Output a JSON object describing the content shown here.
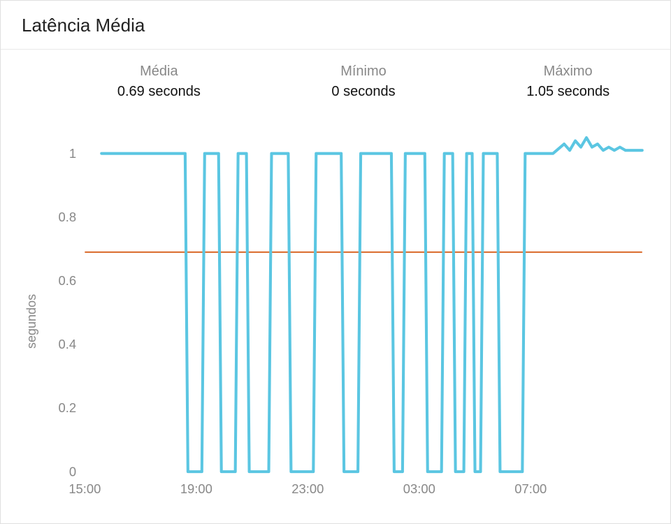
{
  "title": "Latência Média",
  "stats": {
    "mean_label": "Média",
    "mean_value": "0.69 seconds",
    "min_label": "Mínimo",
    "min_value": "0 seconds",
    "max_label": "Máximo",
    "max_value": "1.05 seconds"
  },
  "y_axis_title": "segundos",
  "chart_data": {
    "type": "line",
    "xlabel": "",
    "ylabel": "segundos",
    "ylim": [
      0,
      1.1
    ],
    "xlim": [
      15,
      35
    ],
    "x_tick_labels": [
      "15:00",
      "19:00",
      "23:00",
      "03:00",
      "07:00"
    ],
    "x_tick_positions": [
      15,
      19,
      23,
      27,
      31
    ],
    "y_ticks": [
      0,
      0.2,
      0.4,
      0.6,
      0.8,
      1
    ],
    "mean_line": 0.69,
    "series": [
      {
        "name": "latency",
        "color": "#5bc6e2",
        "x": [
          15.6,
          18.6,
          18.7,
          19.2,
          19.3,
          19.8,
          19.9,
          20.4,
          20.5,
          20.8,
          20.9,
          21.6,
          21.7,
          22.3,
          22.4,
          23.2,
          23.3,
          24.2,
          24.3,
          24.8,
          24.9,
          26.0,
          26.1,
          26.4,
          26.5,
          27.2,
          27.3,
          27.8,
          27.9,
          28.2,
          28.3,
          28.6,
          28.7,
          28.9,
          29.0,
          29.2,
          29.3,
          29.8,
          29.9,
          30.7,
          30.8,
          31.7,
          31.8,
          32.2,
          32.4,
          32.6,
          32.8,
          33.0,
          33.2,
          33.4,
          33.6,
          33.8,
          34.0,
          34.2,
          34.4,
          34.6,
          34.8,
          35.0
        ],
        "values": [
          1,
          1,
          0,
          0,
          1,
          1,
          0,
          0,
          1,
          1,
          0,
          0,
          1,
          1,
          0,
          0,
          1,
          1,
          0,
          0,
          1,
          1,
          0,
          0,
          1,
          1,
          0,
          0,
          1,
          1,
          0,
          0,
          1,
          1,
          0,
          0,
          1,
          1,
          0,
          0,
          1,
          1,
          1.0,
          1.03,
          1.01,
          1.04,
          1.02,
          1.05,
          1.02,
          1.03,
          1.01,
          1.02,
          1.01,
          1.02,
          1.01,
          1.01,
          1.01,
          1.01
        ]
      }
    ]
  }
}
